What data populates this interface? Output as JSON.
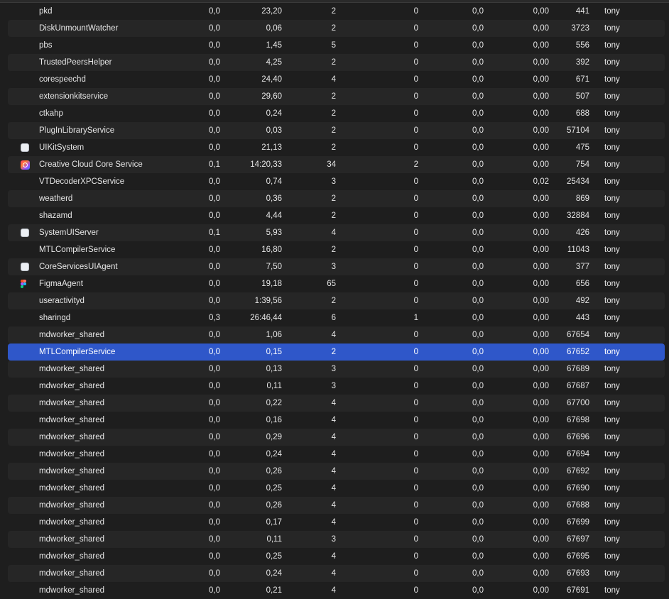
{
  "rows": [
    {
      "name": "pkd",
      "cpu": "0,0",
      "cpu_time": "23,20",
      "threads": "2",
      "idle_wake_ups": "0",
      "gpu": "0,0",
      "gpu_time": "0,00",
      "pid": "441",
      "user": "tony",
      "icon": "none"
    },
    {
      "name": "DiskUnmountWatcher",
      "cpu": "0,0",
      "cpu_time": "0,06",
      "threads": "2",
      "idle_wake_ups": "0",
      "gpu": "0,0",
      "gpu_time": "0,00",
      "pid": "3723",
      "user": "tony",
      "icon": "none"
    },
    {
      "name": "pbs",
      "cpu": "0,0",
      "cpu_time": "1,45",
      "threads": "5",
      "idle_wake_ups": "0",
      "gpu": "0,0",
      "gpu_time": "0,00",
      "pid": "556",
      "user": "tony",
      "icon": "none"
    },
    {
      "name": "TrustedPeersHelper",
      "cpu": "0,0",
      "cpu_time": "4,25",
      "threads": "2",
      "idle_wake_ups": "0",
      "gpu": "0,0",
      "gpu_time": "0,00",
      "pid": "392",
      "user": "tony",
      "icon": "none"
    },
    {
      "name": "corespeechd",
      "cpu": "0,0",
      "cpu_time": "24,40",
      "threads": "4",
      "idle_wake_ups": "0",
      "gpu": "0,0",
      "gpu_time": "0,00",
      "pid": "671",
      "user": "tony",
      "icon": "none"
    },
    {
      "name": "extensionkitservice",
      "cpu": "0,0",
      "cpu_time": "29,60",
      "threads": "2",
      "idle_wake_ups": "0",
      "gpu": "0,0",
      "gpu_time": "0,00",
      "pid": "507",
      "user": "tony",
      "icon": "none"
    },
    {
      "name": "ctkahp",
      "cpu": "0,0",
      "cpu_time": "0,24",
      "threads": "2",
      "idle_wake_ups": "0",
      "gpu": "0,0",
      "gpu_time": "0,00",
      "pid": "688",
      "user": "tony",
      "icon": "none"
    },
    {
      "name": "PlugInLibraryService",
      "cpu": "0,0",
      "cpu_time": "0,03",
      "threads": "2",
      "idle_wake_ups": "0",
      "gpu": "0,0",
      "gpu_time": "0,00",
      "pid": "57104",
      "user": "tony",
      "icon": "none"
    },
    {
      "name": "UIKitSystem",
      "cpu": "0,0",
      "cpu_time": "21,13",
      "threads": "2",
      "idle_wake_ups": "0",
      "gpu": "0,0",
      "gpu_time": "0,00",
      "pid": "475",
      "user": "tony",
      "icon": "app-icon"
    },
    {
      "name": "Creative Cloud Core Service",
      "cpu": "0,1",
      "cpu_time": "14:20,33",
      "threads": "34",
      "idle_wake_ups": "2",
      "gpu": "0,0",
      "gpu_time": "0,00",
      "pid": "754",
      "user": "tony",
      "icon": "creative-cloud-icon"
    },
    {
      "name": "VTDecoderXPCService",
      "cpu": "0,0",
      "cpu_time": "0,74",
      "threads": "3",
      "idle_wake_ups": "0",
      "gpu": "0,0",
      "gpu_time": "0,02",
      "pid": "25434",
      "user": "tony",
      "icon": "none"
    },
    {
      "name": "weatherd",
      "cpu": "0,0",
      "cpu_time": "0,36",
      "threads": "2",
      "idle_wake_ups": "0",
      "gpu": "0,0",
      "gpu_time": "0,00",
      "pid": "869",
      "user": "tony",
      "icon": "none"
    },
    {
      "name": "shazamd",
      "cpu": "0,0",
      "cpu_time": "4,44",
      "threads": "2",
      "idle_wake_ups": "0",
      "gpu": "0,0",
      "gpu_time": "0,00",
      "pid": "32884",
      "user": "tony",
      "icon": "none"
    },
    {
      "name": "SystemUIServer",
      "cpu": "0,1",
      "cpu_time": "5,93",
      "threads": "4",
      "idle_wake_ups": "0",
      "gpu": "0,0",
      "gpu_time": "0,00",
      "pid": "426",
      "user": "tony",
      "icon": "app-icon"
    },
    {
      "name": "MTLCompilerService",
      "cpu": "0,0",
      "cpu_time": "16,80",
      "threads": "2",
      "idle_wake_ups": "0",
      "gpu": "0,0",
      "gpu_time": "0,00",
      "pid": "11043",
      "user": "tony",
      "icon": "none"
    },
    {
      "name": "CoreServicesUIAgent",
      "cpu": "0,0",
      "cpu_time": "7,50",
      "threads": "3",
      "idle_wake_ups": "0",
      "gpu": "0,0",
      "gpu_time": "0,00",
      "pid": "377",
      "user": "tony",
      "icon": "app-icon"
    },
    {
      "name": "FigmaAgent",
      "cpu": "0,0",
      "cpu_time": "19,18",
      "threads": "65",
      "idle_wake_ups": "0",
      "gpu": "0,0",
      "gpu_time": "0,00",
      "pid": "656",
      "user": "tony",
      "icon": "figma-icon"
    },
    {
      "name": "useractivityd",
      "cpu": "0,0",
      "cpu_time": "1:39,56",
      "threads": "2",
      "idle_wake_ups": "0",
      "gpu": "0,0",
      "gpu_time": "0,00",
      "pid": "492",
      "user": "tony",
      "icon": "none"
    },
    {
      "name": "sharingd",
      "cpu": "0,3",
      "cpu_time": "26:46,44",
      "threads": "6",
      "idle_wake_ups": "1",
      "gpu": "0,0",
      "gpu_time": "0,00",
      "pid": "443",
      "user": "tony",
      "icon": "none"
    },
    {
      "name": "mdworker_shared",
      "cpu": "0,0",
      "cpu_time": "1,06",
      "threads": "4",
      "idle_wake_ups": "0",
      "gpu": "0,0",
      "gpu_time": "0,00",
      "pid": "67654",
      "user": "tony",
      "icon": "none"
    },
    {
      "name": "MTLCompilerService",
      "cpu": "0,0",
      "cpu_time": "0,15",
      "threads": "2",
      "idle_wake_ups": "0",
      "gpu": "0,0",
      "gpu_time": "0,00",
      "pid": "67652",
      "user": "tony",
      "icon": "none",
      "selected": true
    },
    {
      "name": "mdworker_shared",
      "cpu": "0,0",
      "cpu_time": "0,13",
      "threads": "3",
      "idle_wake_ups": "0",
      "gpu": "0,0",
      "gpu_time": "0,00",
      "pid": "67689",
      "user": "tony",
      "icon": "none"
    },
    {
      "name": "mdworker_shared",
      "cpu": "0,0",
      "cpu_time": "0,11",
      "threads": "3",
      "idle_wake_ups": "0",
      "gpu": "0,0",
      "gpu_time": "0,00",
      "pid": "67687",
      "user": "tony",
      "icon": "none"
    },
    {
      "name": "mdworker_shared",
      "cpu": "0,0",
      "cpu_time": "0,22",
      "threads": "4",
      "idle_wake_ups": "0",
      "gpu": "0,0",
      "gpu_time": "0,00",
      "pid": "67700",
      "user": "tony",
      "icon": "none"
    },
    {
      "name": "mdworker_shared",
      "cpu": "0,0",
      "cpu_time": "0,16",
      "threads": "4",
      "idle_wake_ups": "0",
      "gpu": "0,0",
      "gpu_time": "0,00",
      "pid": "67698",
      "user": "tony",
      "icon": "none"
    },
    {
      "name": "mdworker_shared",
      "cpu": "0,0",
      "cpu_time": "0,29",
      "threads": "4",
      "idle_wake_ups": "0",
      "gpu": "0,0",
      "gpu_time": "0,00",
      "pid": "67696",
      "user": "tony",
      "icon": "none"
    },
    {
      "name": "mdworker_shared",
      "cpu": "0,0",
      "cpu_time": "0,24",
      "threads": "4",
      "idle_wake_ups": "0",
      "gpu": "0,0",
      "gpu_time": "0,00",
      "pid": "67694",
      "user": "tony",
      "icon": "none"
    },
    {
      "name": "mdworker_shared",
      "cpu": "0,0",
      "cpu_time": "0,26",
      "threads": "4",
      "idle_wake_ups": "0",
      "gpu": "0,0",
      "gpu_time": "0,00",
      "pid": "67692",
      "user": "tony",
      "icon": "none"
    },
    {
      "name": "mdworker_shared",
      "cpu": "0,0",
      "cpu_time": "0,25",
      "threads": "4",
      "idle_wake_ups": "0",
      "gpu": "0,0",
      "gpu_time": "0,00",
      "pid": "67690",
      "user": "tony",
      "icon": "none"
    },
    {
      "name": "mdworker_shared",
      "cpu": "0,0",
      "cpu_time": "0,26",
      "threads": "4",
      "idle_wake_ups": "0",
      "gpu": "0,0",
      "gpu_time": "0,00",
      "pid": "67688",
      "user": "tony",
      "icon": "none"
    },
    {
      "name": "mdworker_shared",
      "cpu": "0,0",
      "cpu_time": "0,17",
      "threads": "4",
      "idle_wake_ups": "0",
      "gpu": "0,0",
      "gpu_time": "0,00",
      "pid": "67699",
      "user": "tony",
      "icon": "none"
    },
    {
      "name": "mdworker_shared",
      "cpu": "0,0",
      "cpu_time": "0,11",
      "threads": "3",
      "idle_wake_ups": "0",
      "gpu": "0,0",
      "gpu_time": "0,00",
      "pid": "67697",
      "user": "tony",
      "icon": "none"
    },
    {
      "name": "mdworker_shared",
      "cpu": "0,0",
      "cpu_time": "0,25",
      "threads": "4",
      "idle_wake_ups": "0",
      "gpu": "0,0",
      "gpu_time": "0,00",
      "pid": "67695",
      "user": "tony",
      "icon": "none"
    },
    {
      "name": "mdworker_shared",
      "cpu": "0,0",
      "cpu_time": "0,24",
      "threads": "4",
      "idle_wake_ups": "0",
      "gpu": "0,0",
      "gpu_time": "0,00",
      "pid": "67693",
      "user": "tony",
      "icon": "none"
    },
    {
      "name": "mdworker_shared",
      "cpu": "0,0",
      "cpu_time": "0,21",
      "threads": "4",
      "idle_wake_ups": "0",
      "gpu": "0,0",
      "gpu_time": "0,00",
      "pid": "67691",
      "user": "tony",
      "icon": "none"
    }
  ],
  "colors": {
    "background": "#1e1e1e",
    "row_alternate": "#262626",
    "row_selected": "#2f57c9",
    "text": "#e6e6e6"
  }
}
